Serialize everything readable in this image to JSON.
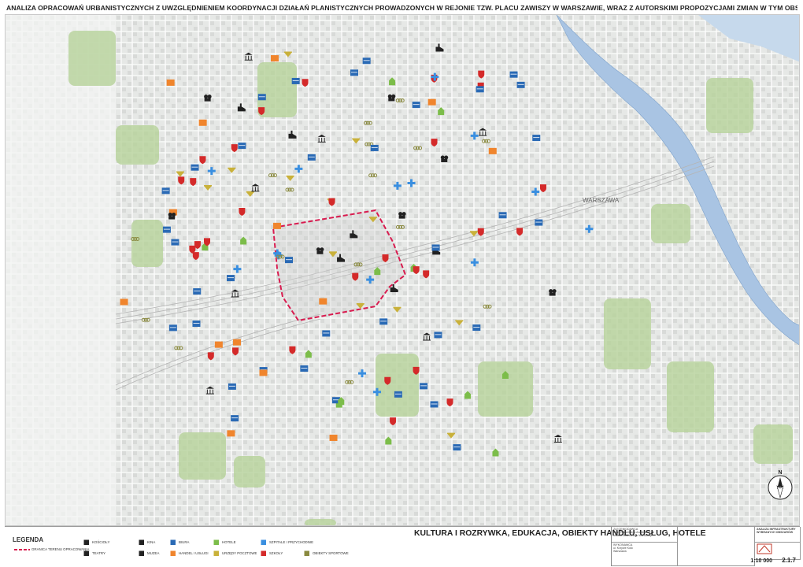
{
  "title": "ANALIZA  OPRACOWAŃ URBANISTYCZNYCH Z UWZGLĘDNIENIEM KOORDYNACJI DZIAŁAŃ PLANISTYCZNYCH PROWADZONYCH W REJONIE TZW.  PLACU ZAWISZY W  WARSZAWIE, WRAZ  Z AUTORSKIMI PROPOZYCJAMI ZMIAN W TYM OBSZARZE",
  "map": {
    "district_label": "WARSZAWA",
    "north_label": "N",
    "boundary_color": "#d81b4f",
    "river_color": "#a9c4e3",
    "green_color": "#b7d29a"
  },
  "theme": "KULTURA I ROZRYWKA, EDUKACJA, OBIEKTY HANDLU, USŁUG, HOTELE",
  "legend": {
    "title": "LEGENDA",
    "boundary": "GRANICA TERENU OPRACOWANIA",
    "items": [
      {
        "icon": "church-icon",
        "label": "KOŚCIOŁY",
        "color": "#222222"
      },
      {
        "icon": "theater-icon",
        "label": "TEATRY",
        "color": "#222222"
      },
      {
        "icon": "cinema-icon",
        "label": "KINA",
        "color": "#222222"
      },
      {
        "icon": "museum-icon",
        "label": "MUZEA",
        "color": "#222222"
      },
      {
        "icon": "office-icon",
        "label": "BIURA",
        "color": "#2a6ab5"
      },
      {
        "icon": "shop-icon",
        "label": "HANDEL I USŁUGI",
        "color": "#f0852d"
      },
      {
        "icon": "hotel-icon",
        "label": "HOTELE",
        "color": "#7cbd4a"
      },
      {
        "icon": "post-office-icon",
        "label": "URZĘDY POCZTOWE",
        "color": "#c9b13a"
      },
      {
        "icon": "hospital-icon",
        "label": "SZPITALE I PRZYCHODNIE",
        "color": "#3a8fe0"
      },
      {
        "icon": "school-icon",
        "label": "SZKOŁY",
        "color": "#d42a2a"
      },
      {
        "icon": "sports-icon",
        "label": "OBIEKTY SPORTOWE",
        "color": "#8a8a40"
      }
    ]
  },
  "title_block": {
    "author_lines": [
      "ZLECENIODAWCA",
      "Biuro Naczelnego Architekta",
      "Miasta Stołecznego Warszawy"
    ],
    "company_lines": [
      "WYKONAWCA",
      "ul. Krzywe Koło",
      "Warszawa"
    ],
    "sheet_title": "ANALIZA INFRASTRUKTURY WYBRANYCH OBSZARÓW",
    "scale": "1:10 000",
    "sheet_number": "2.1.7"
  }
}
